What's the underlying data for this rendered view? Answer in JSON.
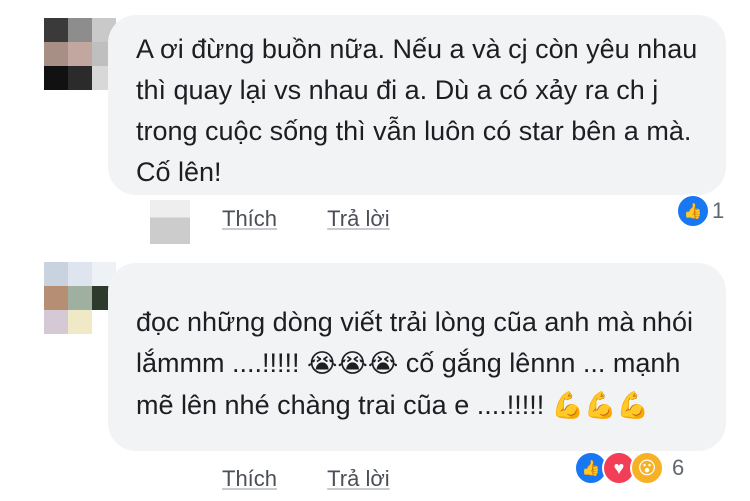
{
  "comments": [
    {
      "text": "A ơi đừng buồn nữa. Nếu a và cj còn yêu nhau thì quay lại vs nhau đi a. Dù a có xảy ra ch j trong cuộc sống thì vẫn luôn có star bên a mà. Cố lên!",
      "like_label": "Thích",
      "reply_label": "Trả lời",
      "reaction_count": "1"
    },
    {
      "text_part": "đọc những dòng viết trải lòng cũa anh mà nhói lắmmm ....!!!!!",
      "text_part2": "cố gắng lênnn ... mạnh mẽ lên nhé chàng trai cũa e ....!!!!!",
      "like_label": "Thích",
      "reply_label": "Trả lời",
      "reaction_count": "6"
    }
  ],
  "icons": {
    "crying": "😭",
    "muscle": "💪",
    "like": "👍",
    "heart": "♥",
    "wow": "😮"
  },
  "colors": {
    "like_blue": "#1877f2",
    "heart_red": "#f33e58",
    "wow_yellow": "#f7b125",
    "muscle_yellow": "#f5c33b"
  }
}
